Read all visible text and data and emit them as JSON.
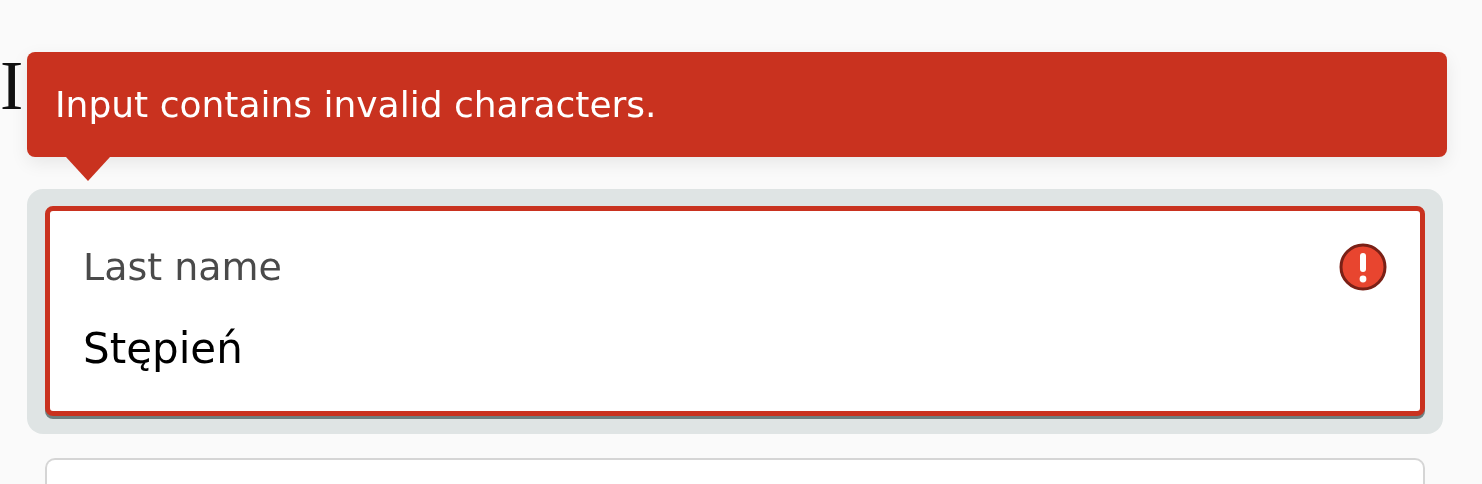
{
  "heading": "I",
  "tooltip": {
    "message": "Input contains invalid characters."
  },
  "fields": [
    {
      "label": "Last name",
      "value": "Stępień",
      "invalid": true,
      "focused": true
    },
    {
      "invalid": false,
      "focused": false
    }
  ]
}
